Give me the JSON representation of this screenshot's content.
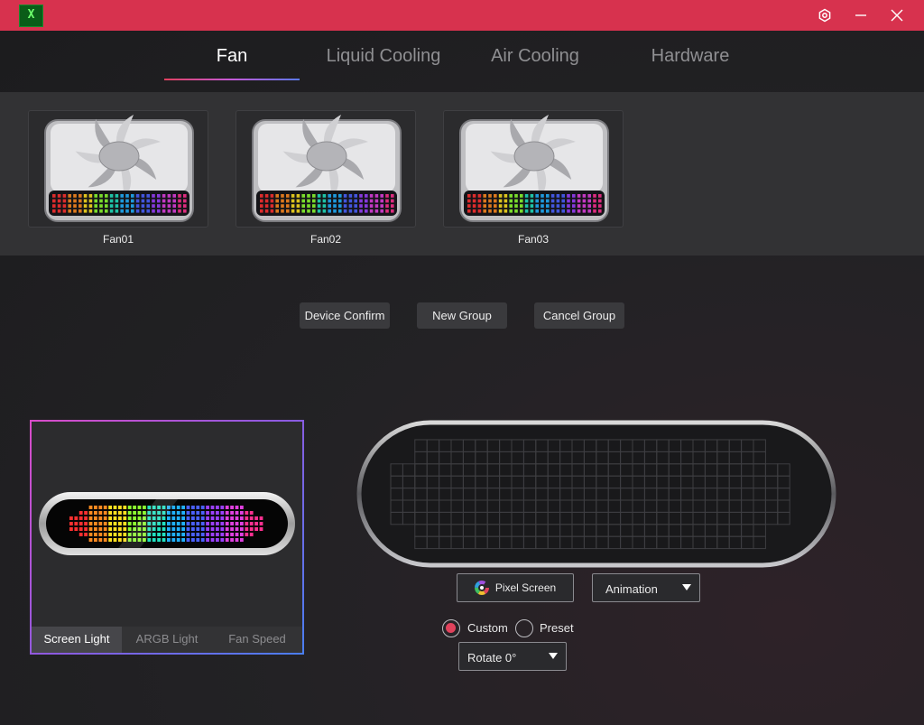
{
  "window": {
    "logo_text": "X",
    "icons": {
      "settings": "gear-icon",
      "minimize": "minimize-icon",
      "close": "close-icon"
    }
  },
  "tabs": [
    {
      "label": "Fan",
      "active": true
    },
    {
      "label": "Liquid Cooling",
      "active": false
    },
    {
      "label": "Air Cooling",
      "active": false
    },
    {
      "label": "Hardware",
      "active": false
    }
  ],
  "fans": [
    {
      "label": "Fan01"
    },
    {
      "label": "Fan02"
    },
    {
      "label": "Fan03"
    }
  ],
  "actions": {
    "device_confirm": "Device Confirm",
    "new_group": "New Group",
    "cancel_group": "Cancel Group"
  },
  "light_panel": {
    "tabs": [
      {
        "label": "Screen Light",
        "active": true
      },
      {
        "label": "ARGB Light",
        "active": false
      },
      {
        "label": "Fan Speed",
        "active": false
      }
    ]
  },
  "controls": {
    "pixel_screen_label": "Pixel Screen",
    "animation_select": "Animation",
    "custom_label": "Custom",
    "preset_label": "Preset",
    "mode_selected": "Custom",
    "rotate_select": "Rotate 0°"
  },
  "colors": {
    "title_bar": "#d7324e",
    "accent": "#e0425c",
    "tab_underline": [
      "#e0405e",
      "#c45ad8",
      "#5a78e8"
    ]
  }
}
